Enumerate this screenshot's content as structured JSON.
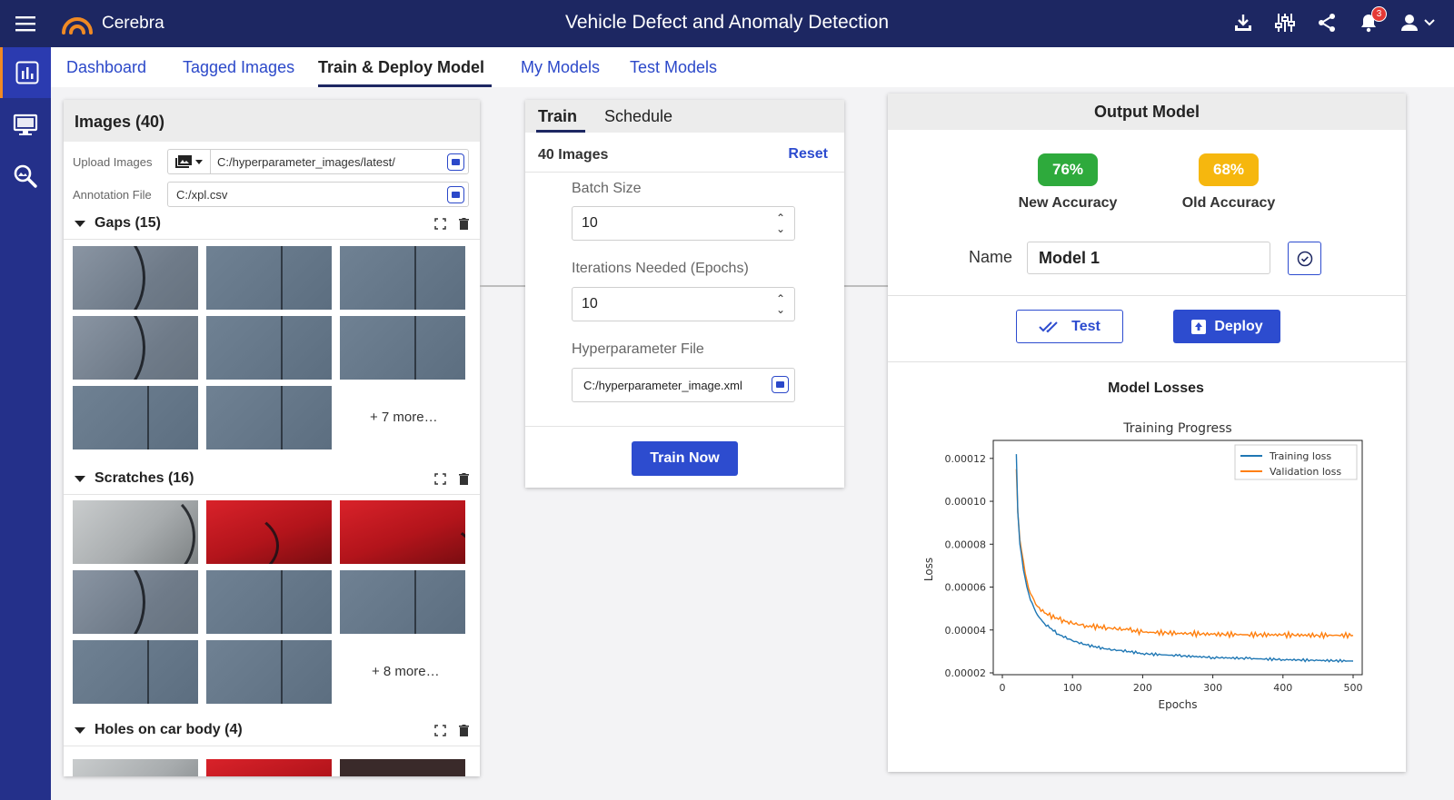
{
  "app": {
    "brand": "Cerebra",
    "title": "Vehicle Defect and Anomaly Detection",
    "notification_count": "3",
    "accent": "#1d2762",
    "primary": "#2d4ccf"
  },
  "nav": {
    "tabs": [
      {
        "label": "Dashboard"
      },
      {
        "label": "Tagged Images"
      },
      {
        "label": "Train & Deploy Model"
      },
      {
        "label": "My Models"
      },
      {
        "label": "Test Models"
      }
    ],
    "active": "Train & Deploy Model"
  },
  "sidebar": {
    "icons": [
      "dashboard-chart-icon",
      "monitor-icon",
      "image-search-icon"
    ]
  },
  "images_panel": {
    "title": "Images (40)",
    "upload_label": "Upload Images",
    "upload_path": "C:/hyperparameter_images/latest/",
    "annotation_label": "Annotation File",
    "annotation_path": "C:/xpl.csv",
    "sections": [
      {
        "title": "Gaps (15)",
        "more": "+ 7 more…"
      },
      {
        "title": "Scratches (16)",
        "more": "+ 8 more…"
      },
      {
        "title": "Holes on car body (4)"
      }
    ]
  },
  "train_panel": {
    "tabs": [
      "Train",
      "Schedule"
    ],
    "images_count": "40 Images",
    "reset": "Reset",
    "batch_label": "Batch Size",
    "batch_value": "10",
    "epochs_label": "Iterations Needed (Epochs)",
    "epochs_value": "10",
    "hyper_label": "Hyperparameter File",
    "hyper_value": "C:/hyperparameter_image.xml",
    "train_button": "Train Now"
  },
  "output_panel": {
    "title": "Output Model",
    "new_accuracy": "76%",
    "new_accuracy_label": "New Accuracy",
    "old_accuracy": "68%",
    "old_accuracy_label": "Old Accuracy",
    "new_color": "#2eaa3c",
    "old_color": "#f6b70e",
    "name_label": "Name",
    "name_value": "Model 1",
    "test_button": "Test",
    "deploy_button": "Deploy",
    "losses_title": "Model Losses"
  },
  "chart_data": {
    "type": "line",
    "title": "Training Progress",
    "xlabel": "Epochs",
    "ylabel": "Loss",
    "xlim": [
      0,
      500
    ],
    "ylim": [
      2e-05,
      0.000125
    ],
    "x_ticks": [
      "0",
      "100",
      "200",
      "300",
      "400",
      "500"
    ],
    "y_ticks": [
      "0.00002",
      "0.00004",
      "0.00006",
      "0.00008",
      "0.00010",
      "0.00012"
    ],
    "legend_position": "top-right",
    "series": [
      {
        "name": "Training loss",
        "color": "#1f77b4",
        "x": [
          20,
          22,
          25,
          30,
          35,
          40,
          50,
          60,
          80,
          100,
          120,
          150,
          180,
          200,
          250,
          300,
          350,
          400,
          450,
          500
        ],
        "y": [
          0.000122,
          9.5e-05,
          8e-05,
          6.8e-05,
          6e-05,
          5.4e-05,
          4.7e-05,
          4.3e-05,
          3.8e-05,
          3.5e-05,
          3.3e-05,
          3.1e-05,
          3e-05,
          2.9e-05,
          2.8e-05,
          2.72e-05,
          2.67e-05,
          2.62e-05,
          2.58e-05,
          2.55e-05
        ]
      },
      {
        "name": "Validation loss",
        "color": "#ff7f0e",
        "x": [
          20,
          22,
          25,
          30,
          35,
          40,
          50,
          60,
          80,
          100,
          120,
          150,
          180,
          200,
          250,
          300,
          350,
          400,
          450,
          500
        ],
        "y": [
          0.000115,
          9.5e-05,
          8.2e-05,
          7.2e-05,
          6.3e-05,
          5.7e-05,
          5.1e-05,
          4.8e-05,
          4.5e-05,
          4.3e-05,
          4.2e-05,
          4.1e-05,
          4e-05,
          3.9e-05,
          3.85e-05,
          3.8e-05,
          3.78e-05,
          3.77e-05,
          3.75e-05,
          3.75e-05
        ]
      }
    ]
  }
}
